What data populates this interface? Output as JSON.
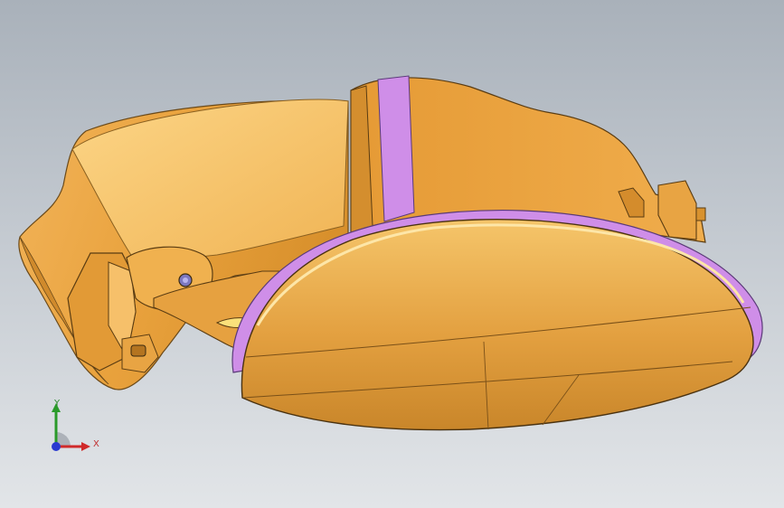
{
  "viewport": {
    "background_top": "#a9b1ba",
    "background_bottom": "#e2e5e8"
  },
  "model": {
    "body_color": "#e9a23d",
    "highlight_color": "#fcd586",
    "shadow_color": "#b8741e",
    "accent_color": "#cf8ee8",
    "edge_color": "#3a2a10"
  },
  "triad": {
    "y_label": "Y",
    "x_label": "X",
    "y_color": "#2a9a2a",
    "x_color": "#d02a2a",
    "z_color": "#2a3ad0"
  }
}
